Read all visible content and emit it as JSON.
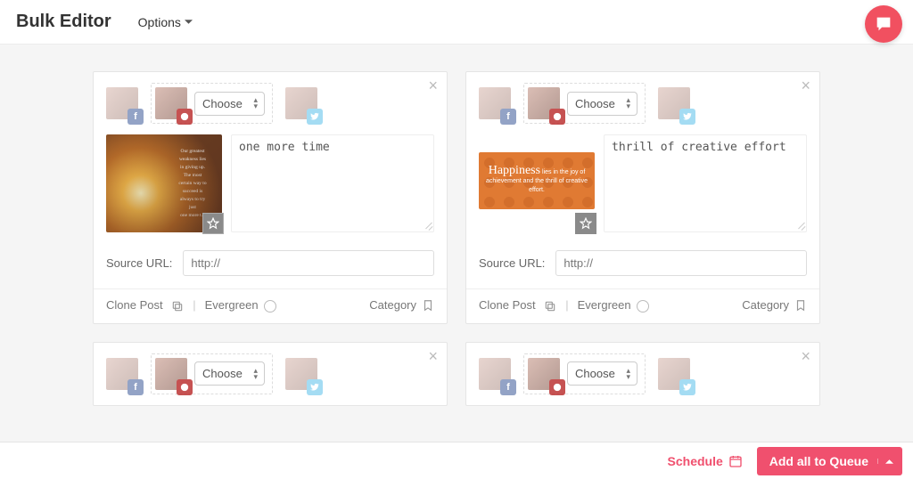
{
  "header": {
    "title": "Bulk Editor",
    "options_label": "Options"
  },
  "select": {
    "placeholder": "Choose"
  },
  "labels": {
    "source_url": "Source URL:",
    "source_placeholder": "http://",
    "clone_post": "Clone Post",
    "evergreen": "Evergreen",
    "category": "Category"
  },
  "posts": [
    {
      "text": "one more time",
      "quote_lines": [
        "Our greatest",
        "weakness lies",
        "in giving up.",
        "The most",
        "certain way to",
        "succeed is",
        "always to try",
        "just",
        "one more t..."
      ]
    },
    {
      "text": "thrill of creative effort",
      "happiness_word": "Happiness",
      "happiness_rest": "lies in the joy of achievement and the thrill of creative effort."
    }
  ],
  "footer": {
    "schedule": "Schedule",
    "add_all": "Add all to Queue"
  }
}
